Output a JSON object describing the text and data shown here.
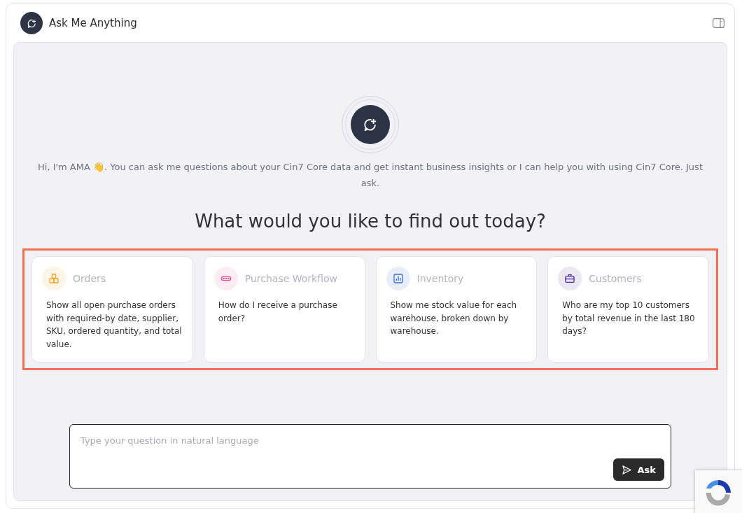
{
  "window": {
    "title": "Ask Me Anything"
  },
  "intro": {
    "greeting": "Hi, I'm AMA 👋. You can ask me questions about your Cin7 Core data and get instant business insights or I can help you with using Cin7 Core. Just ask.",
    "heading": "What would you like to find out today?"
  },
  "suggestions": {
    "highlighted": true,
    "cards": [
      {
        "kind": "orders",
        "color": "#f5a524",
        "title": "Orders",
        "prompt": "Show all open purchase orders with required-by date, supplier, SKU, ordered quantity, and total value."
      },
      {
        "kind": "workflow",
        "color": "#e8508f",
        "title": "Purchase Workflow",
        "prompt": "How do I receive a purchase order?"
      },
      {
        "kind": "inventory",
        "color": "#3b6fd4",
        "title": "Inventory",
        "prompt": "Show me stock value for each warehouse, broken down by warehouse."
      },
      {
        "kind": "customers",
        "color": "#4b2a9e",
        "title": "Customers",
        "prompt": "Who are my top 10 customers by total revenue in the last 180 days?"
      }
    ]
  },
  "composer": {
    "placeholder": "Type your question in natural language",
    "button": "Ask"
  }
}
